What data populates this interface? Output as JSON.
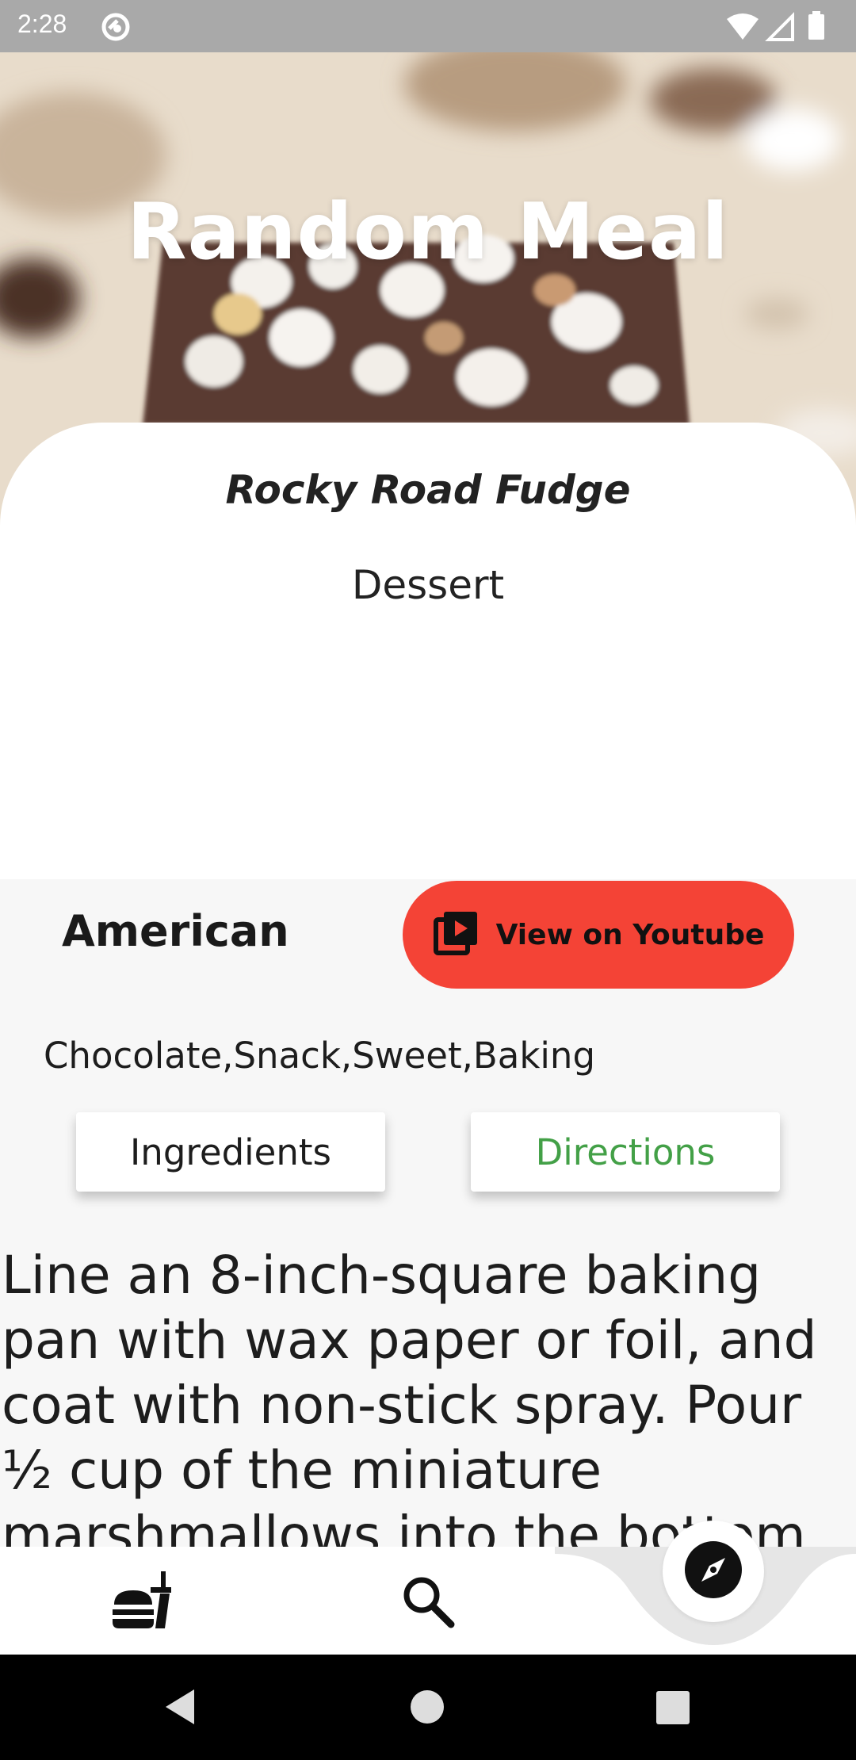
{
  "status_bar": {
    "time": "2:28"
  },
  "header": {
    "title": "Random Meal"
  },
  "meal": {
    "name": "Rocky Road Fudge",
    "category": "Dessert",
    "area": "American",
    "tags": "Chocolate,Snack,Sweet,Baking",
    "youtube_label": "View on Youtube"
  },
  "tabs": {
    "ingredients": "Ingredients",
    "directions": "Directions"
  },
  "directions_text": "Line an 8-inch-square baking pan with wax paper or foil, and coat with non-stick spray. Pour ½ cup of the miniature marshmallows into the bottom",
  "bottom_nav": {
    "items": [
      "food-icon",
      "search-icon",
      "explore-compass-icon"
    ],
    "active": "explore"
  },
  "colors": {
    "youtube_button": "#f44336",
    "directions_active": "#43a047",
    "status_bar": "#a9a9a9"
  }
}
